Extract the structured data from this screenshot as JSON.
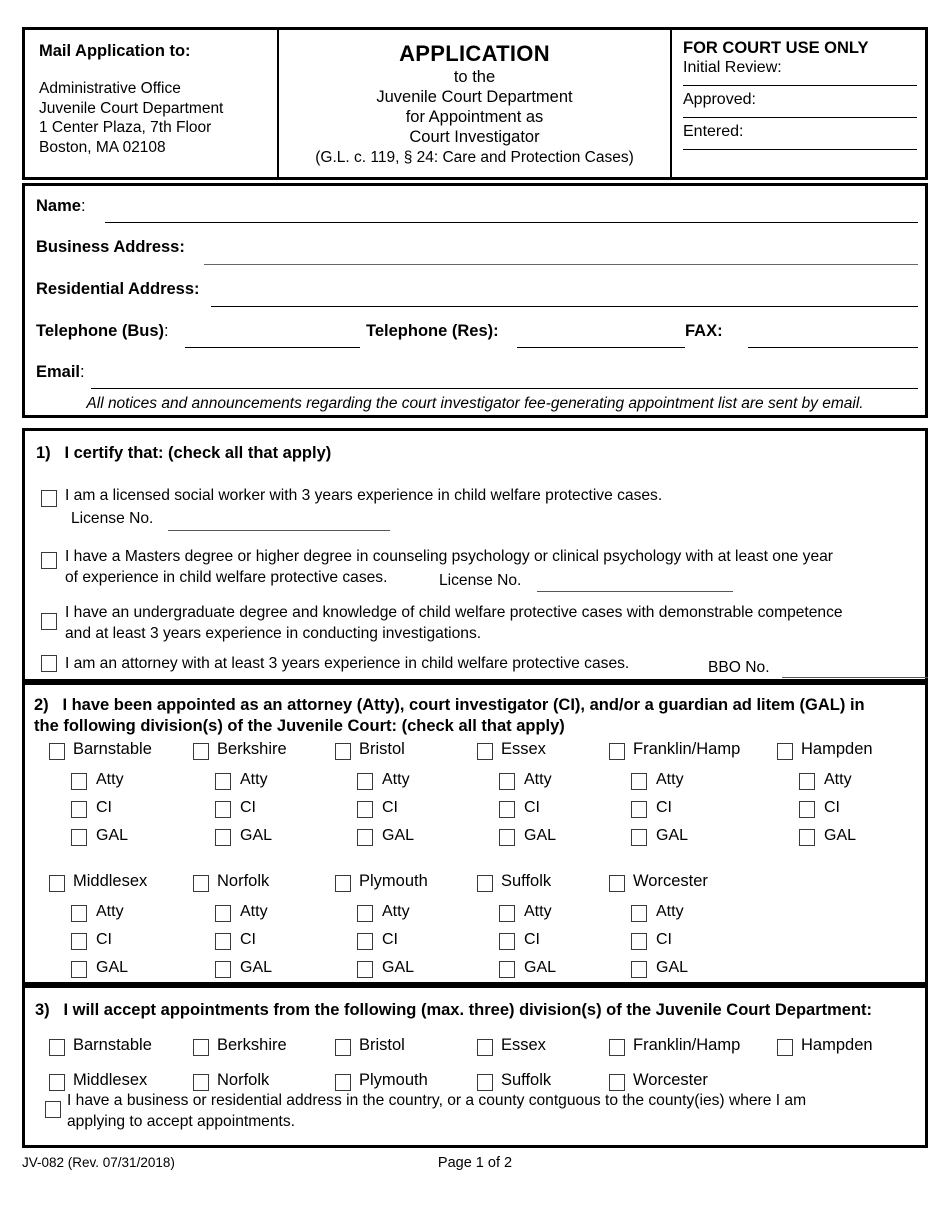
{
  "header": {
    "mail_heading": "Mail Application to:",
    "mail_address": [
      "Administrative Office",
      "Juvenile Court Department",
      "1 Center Plaza, 7th Floor",
      "Boston, MA 02108"
    ],
    "title": "APPLICATION",
    "subtitle_lines": [
      "to the",
      "Juvenile Court Department",
      "for Appointment as",
      "Court Investigator"
    ],
    "citation": "(G.L. c. 119, § 24: Care and Protection Cases)",
    "court_use": {
      "heading": "FOR COURT USE ONLY",
      "fields": [
        "Initial Review:",
        "Approved:",
        "Entered:"
      ]
    }
  },
  "contact": {
    "name_label": "Name",
    "business_address_label": "Business Address:",
    "residential_address_label": "Residential Address:",
    "telephone_bus_label": "Telephone (Bus)",
    "telephone_res_label": "Telephone (Res):",
    "fax_label": "FAX:",
    "email_label": "Email",
    "colon": ":",
    "notice": "All notices and announcements regarding the court investigator fee-generating appointment list are sent by email."
  },
  "section1": {
    "number": "1)",
    "heading": "I certify that: (check all that apply)",
    "items": [
      {
        "text": "I am a licensed social worker with 3 years experience in child welfare protective cases.",
        "sub_label": "License No."
      },
      {
        "text_line1": "I have a Masters degree or higher degree in counseling psychology or clinical psychology with at least one year",
        "text_line2": "of experience in child welfare protective cases.",
        "sub_label": "License No."
      },
      {
        "text_line1": "I have an undergraduate degree and knowledge of child welfare protective cases with demonstrable competence",
        "text_line2": "and at least 3 years experience in conducting investigations."
      },
      {
        "text": "I am an attorney with at least 3 years experience in child welfare protective cases.",
        "sub_label": "BBO No."
      }
    ]
  },
  "section2": {
    "number": "2)",
    "heading_line1": "I have been appointed as an attorney (Atty), court investigator (CI), and/or a guardian ad litem (GAL) in",
    "heading_line2": "the following division(s) of the Juvenile Court: (check all that apply)",
    "roles": [
      "Atty",
      "CI",
      "GAL"
    ],
    "row1": [
      "Barnstable",
      "Berkshire",
      "Bristol",
      "Essex",
      "Franklin/Hamp",
      "Hampden"
    ],
    "row2": [
      "Middlesex",
      "Norfolk",
      "Plymouth",
      "Suffolk",
      "Worcester"
    ]
  },
  "section3": {
    "number": "3)",
    "heading": "I will accept appointments from the following (max. three) division(s) of the Juvenile Court Department:",
    "row1": [
      "Barnstable",
      "Berkshire",
      "Bristol",
      "Essex",
      "Franklin/Hamp",
      "Hampden"
    ],
    "row2": [
      "Middlesex",
      "Norfolk",
      "Plymouth",
      "Suffolk",
      "Worcester"
    ],
    "residency_line1": "I have a business or residential address in the country, or a county contguous to the county(ies) where I am",
    "residency_line2": "applying to accept appointments."
  },
  "footer": {
    "form_id": "JV-082 (Rev. 07/31/2018)",
    "page": "Page 1 of 2"
  }
}
